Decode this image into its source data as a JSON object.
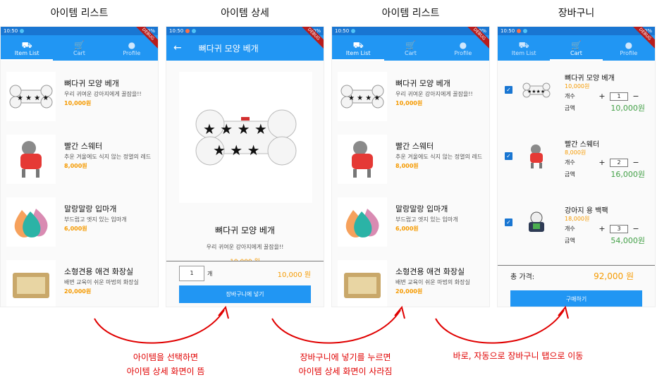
{
  "captions": [
    "아이템 리스트",
    "아이템 상세",
    "아이템 리스트",
    "장바구니"
  ],
  "status": {
    "time": "10:50",
    "battery": "100%",
    "debug": "DEBUG"
  },
  "tabs": [
    "Item List",
    "Cart",
    "Profile"
  ],
  "items": [
    {
      "name": "뼈다귀 모양 베개",
      "desc": "우리 귀여운 강아지에게 꿀잠을!!",
      "price": "10,000원"
    },
    {
      "name": "빨간 스웨터",
      "desc": "추운 겨울에도 식지 않는 정열의 레드",
      "price": "8,000원"
    },
    {
      "name": "말랑말랑 입마개",
      "desc": "부드럽고 엣지 있는 입마개",
      "price": "6,000원"
    },
    {
      "name": "소형견용 애견 화장실",
      "desc": "배변 교육이 쉬운 마법의 화장실",
      "price": "20,000원"
    }
  ],
  "detail": {
    "title": "뼈다귀 모양 베개",
    "name": "뼈다귀 모양 베개",
    "desc": "우리 귀여운 강아지에게 꿀잠을!!",
    "price": "10,000 원",
    "qty": "1",
    "unit": "개",
    "total": "10,000 원",
    "button": "장바구니에 넣기"
  },
  "cart": {
    "items": [
      {
        "name": "뼈다귀 모양 베개",
        "price": "10,000원",
        "qty_label": "개수",
        "qty": "1",
        "sum_label": "금액",
        "sum": "10,000원"
      },
      {
        "name": "빨간 스웨터",
        "price": "8,000원",
        "qty_label": "개수",
        "qty": "2",
        "sum_label": "금액",
        "sum": "16,000원"
      },
      {
        "name": "강아지 용 백팩",
        "price": "18,000원",
        "qty_label": "개수",
        "qty": "3",
        "sum_label": "금액",
        "sum": "54,000원"
      }
    ],
    "total_label": "총 가격:",
    "total": "92,000 원",
    "buy": "구매하기"
  },
  "notes": {
    "n1_line1": "아이템을 선택하면",
    "n1_line2": "아이템 상세 화면이 뜸",
    "n2_line1": "장바구니에 넣기를 누르면",
    "n2_line2": "아이템 상세 화면이 사라짐",
    "n3": "바로, 자동으로 장바구니 탭으로 이동"
  },
  "colors": {
    "primary": "#2196f3",
    "price": "#f59a00",
    "sum": "#43a047",
    "note": "#e00000"
  }
}
